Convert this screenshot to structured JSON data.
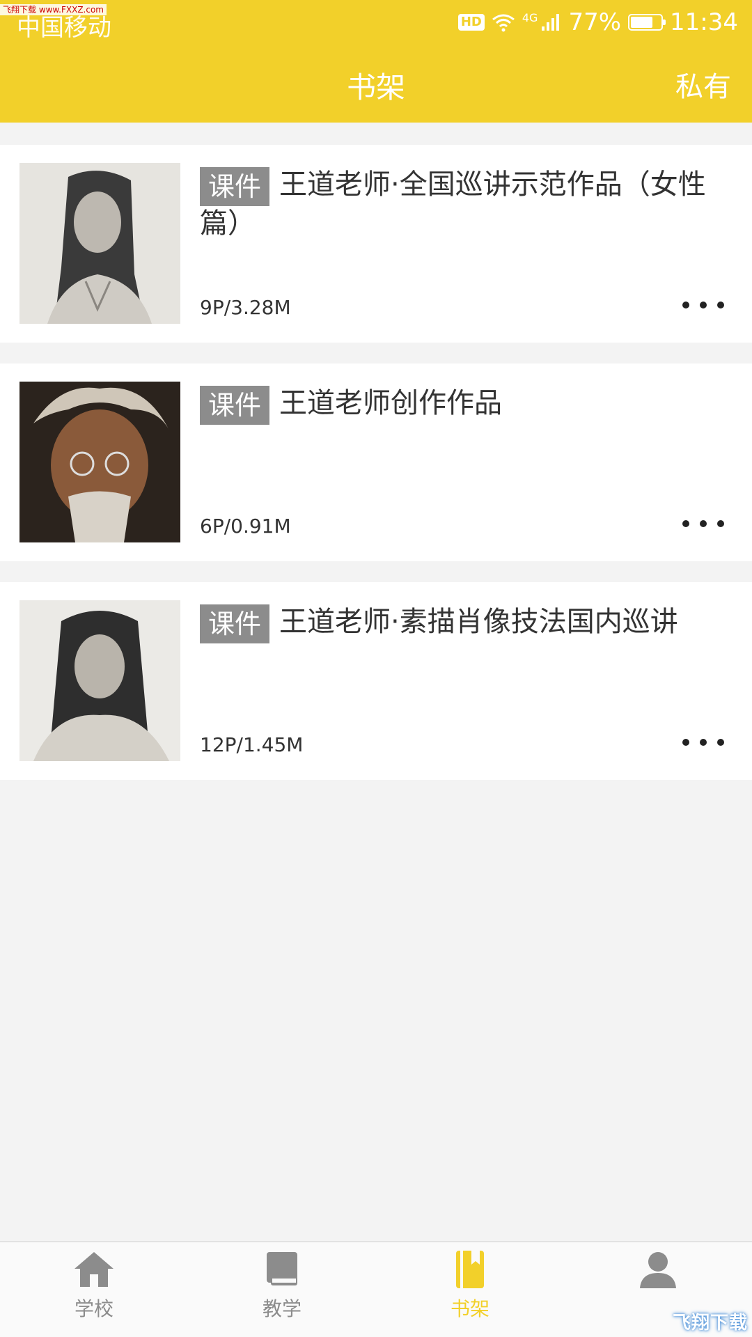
{
  "status_bar": {
    "carrier": "中国移动",
    "watermark": "飞翔下载 www.FXXZ.com",
    "hd": "HD",
    "network": "4G",
    "battery": "77%",
    "battery_level": 0.77,
    "time": "11:34"
  },
  "header": {
    "title": "书架",
    "right_action": "私有"
  },
  "items": [
    {
      "tag": "课件",
      "title": "王道老师·全国巡讲示范作品（女性篇）",
      "meta": "9P/3.28M"
    },
    {
      "tag": "课件",
      "title": "王道老师创作作品",
      "meta": "6P/0.91M"
    },
    {
      "tag": "课件",
      "title": "王道老师·素描肖像技法国内巡讲",
      "meta": "12P/1.45M"
    }
  ],
  "tabs": [
    {
      "label": "学校",
      "icon": "home-icon",
      "active": false
    },
    {
      "label": "教学",
      "icon": "book-icon",
      "active": false
    },
    {
      "label": "书架",
      "icon": "bookmark-book-icon",
      "active": true
    },
    {
      "label": "",
      "icon": "user-icon",
      "active": false
    }
  ],
  "corner_watermark": "飞翔下载",
  "colors": {
    "accent": "#f2d02a",
    "tag_bg": "#8c8c8c",
    "inactive": "#8c8c8c"
  }
}
